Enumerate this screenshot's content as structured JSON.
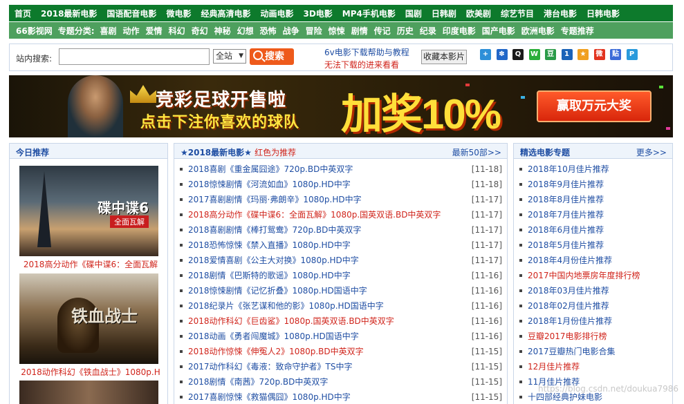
{
  "nav_primary": [
    "首页",
    "2018最新电影",
    "国语配音电影",
    "微电影",
    "经典高清电影",
    "动画电影",
    "3D电影",
    "MP4手机电影",
    "国剧",
    "日韩剧",
    "欧美剧",
    "综艺节目",
    "港台电影",
    "日韩电影"
  ],
  "nav_secondary": {
    "site": "66影视网",
    "label": "专题分类:",
    "items": [
      "喜剧",
      "动作",
      "爱情",
      "科幻",
      "奇幻",
      "神秘",
      "幻想",
      "恐怖",
      "战争",
      "冒险",
      "惊悚",
      "剧情",
      "传记",
      "历史",
      "纪录",
      "印度电影",
      "国产电影",
      "欧洲电影",
      "专题推荐"
    ]
  },
  "search": {
    "label": "站内搜索:",
    "value": "",
    "select": "全站",
    "button": "搜索",
    "help_link": "6v电影下载帮助与教程",
    "help_red": "无法下载的进来看看",
    "favorite": "收藏本影片"
  },
  "share_icons": [
    {
      "name": "plus-share-icon",
      "color": "#2d8fd8",
      "glyph": "+"
    },
    {
      "name": "grid-share-icon",
      "color": "#2167c8",
      "glyph": "✽"
    },
    {
      "name": "qq-share-icon",
      "color": "#1a1a1a",
      "glyph": "Q"
    },
    {
      "name": "wechat-share-icon",
      "color": "#2aae3a",
      "glyph": "W"
    },
    {
      "name": "douban-share-icon",
      "color": "#2a9b48",
      "glyph": "豆"
    },
    {
      "name": "renren-share-icon",
      "color": "#1a62b8",
      "glyph": "1"
    },
    {
      "name": "qzone-share-icon",
      "color": "#f0a020",
      "glyph": "★"
    },
    {
      "name": "weibo-share-icon",
      "color": "#e2331f",
      "glyph": "微"
    },
    {
      "name": "tieba-share-icon",
      "color": "#3a6ad8",
      "glyph": "贴"
    },
    {
      "name": "pinterest-share-icon",
      "color": "#2a9adc",
      "glyph": "P"
    }
  ],
  "banner": {
    "line1": "竞彩足球开售啦",
    "line2": "点击下注你喜欢的球队",
    "promo": "加奖10%",
    "cta": "赢取万元大奖"
  },
  "left_panel": {
    "title": "今日推荐",
    "posters": [
      {
        "title": "碟中谍6",
        "subtitle": "全面瓦解",
        "caption": "2018高分动作《碟中谍6：全面瓦解"
      },
      {
        "title": "铁血战士",
        "caption": "2018动作科幻《铁血战士》1080p.H"
      }
    ]
  },
  "middle_panel": {
    "title": "★2018最新电影★",
    "note": "红色为推荐",
    "more": "最新50部>>",
    "items": [
      {
        "text": "2018喜剧《重金属囧途》720p.BD中英双字",
        "date": "[11-18]",
        "red": false
      },
      {
        "text": "2018惊悚剧情《河流如血》1080p.HD中字",
        "date": "[11-18]",
        "red": false
      },
      {
        "text": "2017喜剧剧情《玛丽·弗朗辛》1080p.HD中字",
        "date": "[11-17]",
        "red": false
      },
      {
        "text": "2018高分动作《碟中谍6：全面瓦解》1080p.国英双语.BD中英双字",
        "date": "[11-17]",
        "red": true
      },
      {
        "text": "2018喜剧剧情《棒打鸳鸯》720p.BD中英双字",
        "date": "[11-17]",
        "red": false
      },
      {
        "text": "2018恐怖惊悚《禁入直播》1080p.HD中字",
        "date": "[11-17]",
        "red": false
      },
      {
        "text": "2018爱情喜剧《公主大对换》1080p.HD中字",
        "date": "[11-17]",
        "red": false
      },
      {
        "text": "2018剧情《巴斯特的歌谣》1080p.HD中字",
        "date": "[11-16]",
        "red": false
      },
      {
        "text": "2018惊悚剧情《记忆折叠》1080p.HD国语中字",
        "date": "[11-16]",
        "red": false
      },
      {
        "text": "2018纪录片《张艺谋和他的影》1080p.HD国语中字",
        "date": "[11-16]",
        "red": false
      },
      {
        "text": "2018动作科幻《巨齿鲨》1080p.国英双语.BD中英双字",
        "date": "[11-16]",
        "red": true
      },
      {
        "text": "2018动画《勇者闯魔城》1080p.HD国语中字",
        "date": "[11-16]",
        "red": false
      },
      {
        "text": "2018动作惊悚《伸冤人2》1080p.BD中英双字",
        "date": "[11-15]",
        "red": true
      },
      {
        "text": "2017动作科幻《毒液：致命守护者》TS中字",
        "date": "[11-15]",
        "red": false
      },
      {
        "text": "2018剧情《南茜》720p.BD中英双字",
        "date": "[11-15]",
        "red": false
      },
      {
        "text": "2017喜剧惊悚《救猫偶囧》1080p.HD中字",
        "date": "[11-15]",
        "red": false
      }
    ]
  },
  "right_panel": {
    "title": "精选电影专题",
    "more": "更多>>",
    "items": [
      {
        "text": "2018年10月佳片推荐",
        "red": false
      },
      {
        "text": "2018年9月佳片推荐",
        "red": false
      },
      {
        "text": "2018年8月佳片推荐",
        "red": false
      },
      {
        "text": "2018年7月佳片推荐",
        "red": false
      },
      {
        "text": "2018年6月佳片推荐",
        "red": false
      },
      {
        "text": "2018年5月佳片推荐",
        "red": false
      },
      {
        "text": "2018年4月份佳片推荐",
        "red": false
      },
      {
        "text": "2017中国内地票房年度排行榜",
        "red": true
      },
      {
        "text": "2018年03月佳片推荐",
        "red": false
      },
      {
        "text": "2018年02月佳片推荐",
        "red": false
      },
      {
        "text": "2018年1月份佳片推荐",
        "red": false
      },
      {
        "text": "豆瓣2017电影排行榜",
        "red": true
      },
      {
        "text": "2017豆瓣热门电影合集",
        "red": false
      },
      {
        "text": "12月佳片推荐",
        "red": true
      },
      {
        "text": "11月佳片推荐",
        "red": false
      },
      {
        "text": "十四部经典护妹电影",
        "red": false
      }
    ]
  },
  "watermark": "https://blog.csdn.net/doukua7986"
}
